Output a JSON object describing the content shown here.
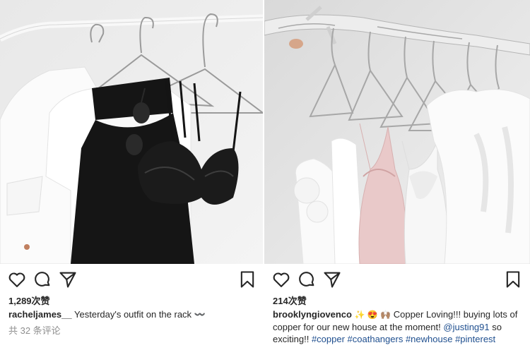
{
  "posts": [
    {
      "likes": "1,289次赞",
      "username": "racheljames__",
      "caption": "Yesterday's outfit on the rack",
      "caption_suffix": "〰️",
      "comments": "共 32 条评论"
    },
    {
      "likes": "214次赞",
      "username": "brooklyngiovenco",
      "emojis": "✨ 😍 🙌🏽",
      "caption_line1": "Copper Loving!!! buying lots of copper for our new house at the moment!",
      "mention": "@justing91",
      "caption_line2": "so exciting!!",
      "hashtags": [
        "#copper",
        "#coathangers",
        "#newhouse",
        "#pinterest"
      ]
    }
  ],
  "icons": [
    "heart-icon",
    "comment-icon",
    "share-icon",
    "bookmark-icon"
  ],
  "colors": {
    "text": "#262626",
    "muted": "#8e8e8e",
    "link": "#1f4f8f",
    "background": "#ffffff"
  }
}
